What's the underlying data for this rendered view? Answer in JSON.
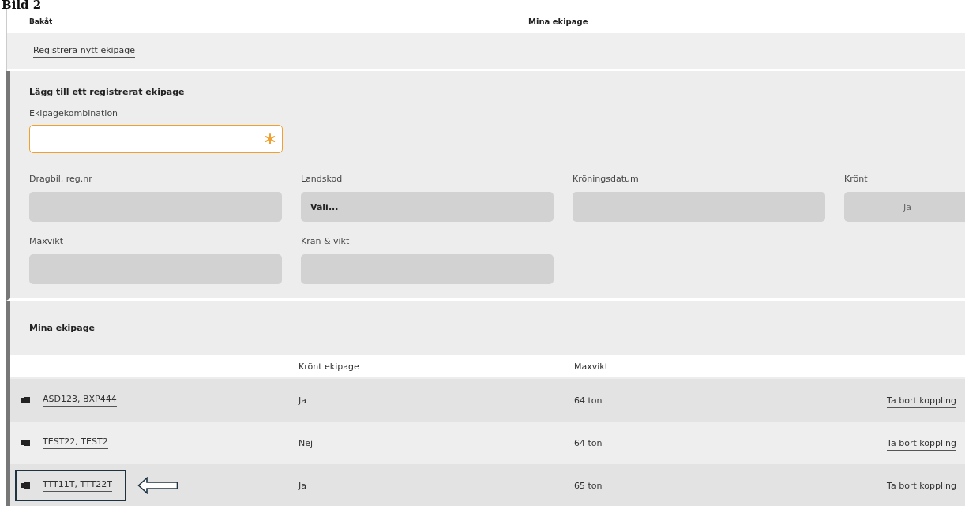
{
  "caption": "Bild 2",
  "header": {
    "back": "Bakåt",
    "title": "Mina ekipage"
  },
  "register_link": "Registrera nytt ekipage",
  "add_form": {
    "title": "Lägg till ett registrerat ekipage",
    "combination": {
      "label": "Ekipagekombination",
      "required": true
    },
    "fields": [
      {
        "kind": "text",
        "label": "Dragbil, reg.nr"
      },
      {
        "kind": "select",
        "label": "Landskod",
        "value": "Väli..."
      },
      {
        "kind": "text",
        "label": "Kröningsdatum"
      },
      {
        "kind": "toggle",
        "label": "Krönt",
        "value": "Ja"
      },
      {
        "kind": "text",
        "label": "Maxvikt"
      },
      {
        "kind": "text",
        "label": "Kran & vikt"
      }
    ]
  },
  "list": {
    "title": "Mina ekipage",
    "columns": [
      "Krönt ekipage",
      "Maxvikt"
    ],
    "rows": [
      {
        "name": "ASD123, BXP444",
        "crowned": "Ja",
        "max_weight": "64 ton",
        "action": "Ta bort koppling",
        "highlighted": false
      },
      {
        "name": "TEST22, TEST2",
        "crowned": "Nej",
        "max_weight": "64 ton",
        "action": "Ta bort koppling",
        "highlighted": false
      },
      {
        "name": "TTT11T, TTT22T",
        "crowned": "Ja",
        "max_weight": "65 ton",
        "action": "Ta bort koppling",
        "highlighted": true
      }
    ]
  }
}
